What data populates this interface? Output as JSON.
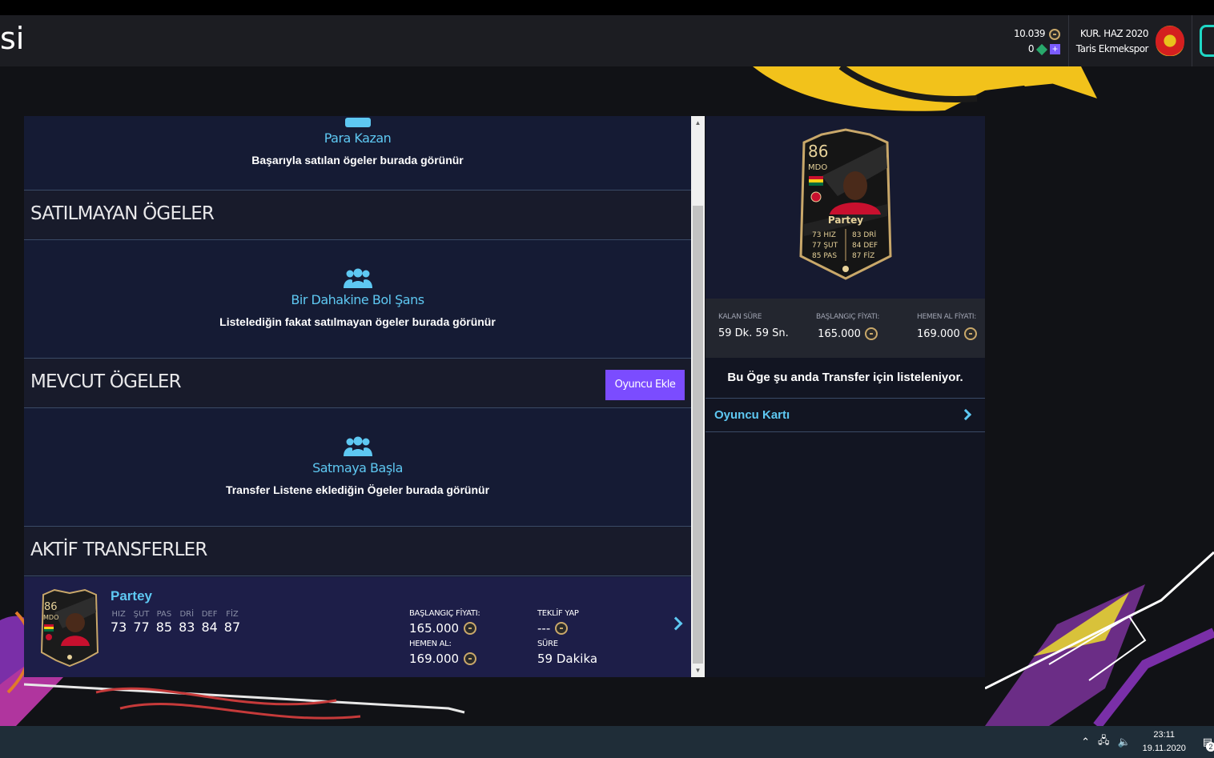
{
  "header": {
    "title_fragment": "si",
    "coins": "10.039",
    "points": "0",
    "club_season": "KUR. HAZ 2020",
    "club_name": "Taris Ekmekspor",
    "plus_symbol": "+"
  },
  "sections": {
    "sold": {
      "empty_title": "Para Kazan",
      "empty_desc": "Başarıyla satılan ögeler burada görünür"
    },
    "unsold": {
      "heading": "SATILMAYAN ÖGELER",
      "empty_title": "Bir Dahakine Bol Şans",
      "empty_desc": "Listelediğin fakat satılmayan ögeler burada görünür"
    },
    "available": {
      "heading": "MEVCUT ÖGELER",
      "add_button": "Oyuncu Ekle",
      "empty_title": "Satmaya Başla",
      "empty_desc": "Transfer Listene eklediğin Ögeler burada görünür"
    },
    "active": {
      "heading": "AKTİF TRANSFERLER"
    }
  },
  "transfer_item": {
    "name": "Partey",
    "rating": "86",
    "position": "MDO",
    "stats": [
      {
        "label": "HIZ",
        "value": "73"
      },
      {
        "label": "ŞUT",
        "value": "77"
      },
      {
        "label": "PAS",
        "value": "85"
      },
      {
        "label": "DRİ",
        "value": "83"
      },
      {
        "label": "DEF",
        "value": "84"
      },
      {
        "label": "FİZ",
        "value": "87"
      }
    ],
    "start_price_label": "BAŞLANGIÇ FİYATI:",
    "start_price": "165.000",
    "buy_now_label": "HEMEN AL:",
    "buy_now": "169.000",
    "bid_label": "TEKLİF YAP",
    "bid_value": "---",
    "time_label": "SÜRE",
    "time_value": "59 Dakika"
  },
  "detail": {
    "card": {
      "rating": "86",
      "position": "MDO",
      "name": "Partey",
      "stats_left": [
        "73 HIZ",
        "77 ŞUT",
        "85 PAS"
      ],
      "stats_right": [
        "83 DRİ",
        "84 DEF",
        "87 FİZ"
      ]
    },
    "time_left_label": "KALAN SÜRE",
    "time_left": "59 Dk. 59 Sn.",
    "start_price_label": "BAŞLANGIÇ FİYATI:",
    "start_price": "165.000",
    "buy_now_label": "HEMEN AL FİYATI:",
    "buy_now": "169.000",
    "listing_message": "Bu Öge şu anda Transfer için listeleniyor.",
    "player_card_link": "Oyuncu Kartı"
  },
  "taskbar": {
    "time": "23:11",
    "date": "19.11.2020",
    "notification_count": "2"
  },
  "colors": {
    "accent_blue": "#5ec8f2",
    "button_purple": "#7b4cff",
    "panel_bg": "#151b34",
    "card_gold": "#c9a86a"
  }
}
